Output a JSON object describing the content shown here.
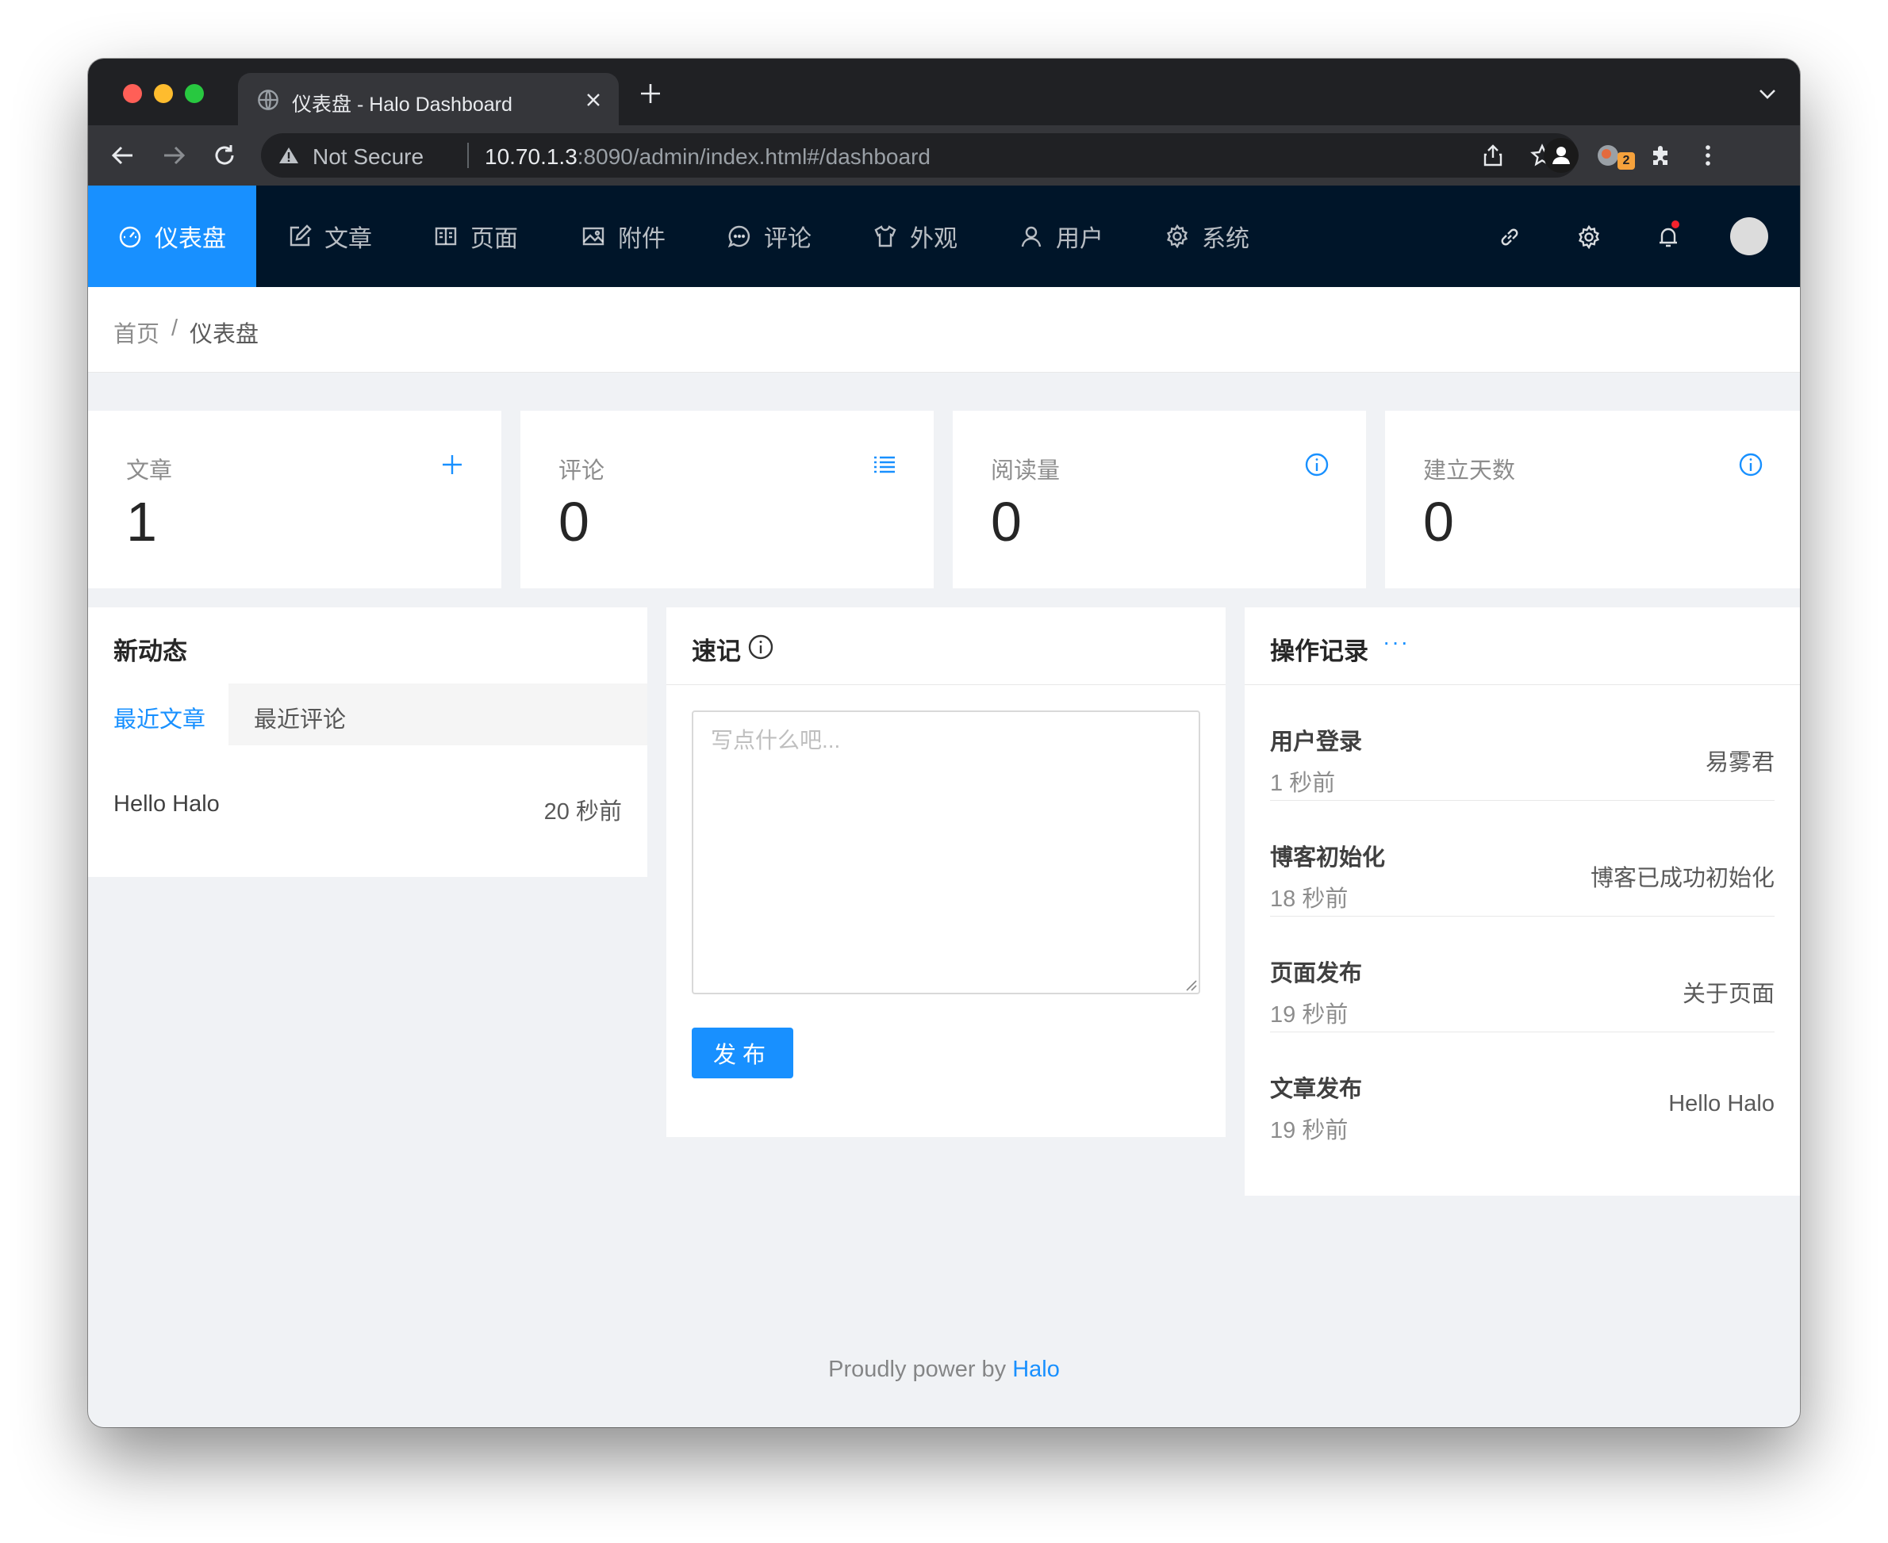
{
  "browser": {
    "tab_title": "仪表盘 - Halo Dashboard",
    "security_label": "Not Secure",
    "url_host": "10.70.1.3",
    "url_path": ":8090/admin/index.html#/dashboard",
    "extension_badge": "2"
  },
  "nav": {
    "items": [
      {
        "label": "仪表盘",
        "icon": "dashboard-icon",
        "active": true
      },
      {
        "label": "文章",
        "icon": "edit-icon"
      },
      {
        "label": "页面",
        "icon": "book-icon"
      },
      {
        "label": "附件",
        "icon": "picture-icon"
      },
      {
        "label": "评论",
        "icon": "message-icon"
      },
      {
        "label": "外观",
        "icon": "skin-icon"
      },
      {
        "label": "用户",
        "icon": "user-icon"
      },
      {
        "label": "系统",
        "icon": "setting-icon"
      }
    ],
    "right_icons": [
      "link-icon",
      "setting-icon",
      "bell-icon",
      "avatar"
    ]
  },
  "breadcrumb": {
    "home": "首页",
    "separator": "/",
    "current": "仪表盘"
  },
  "stats": [
    {
      "label": "文章",
      "value": "1",
      "action_icon": "plus-icon"
    },
    {
      "label": "评论",
      "value": "0",
      "action_icon": "list-icon"
    },
    {
      "label": "阅读量",
      "value": "0",
      "action_icon": "info-circle-icon"
    },
    {
      "label": "建立天数",
      "value": "0",
      "action_icon": "info-circle-icon"
    }
  ],
  "activity": {
    "title": "新动态",
    "tabs": [
      "最近文章",
      "最近评论"
    ],
    "posts": [
      {
        "title": "Hello Halo",
        "time": "20 秒前"
      }
    ]
  },
  "memo": {
    "title": "速记",
    "placeholder": "写点什么吧...",
    "publish_label": "发布"
  },
  "log": {
    "title": "操作记录",
    "more": "···",
    "rows": [
      {
        "type": "用户登录",
        "time": "1 秒前",
        "detail": "易雾君"
      },
      {
        "type": "博客初始化",
        "time": "18 秒前",
        "detail": "博客已成功初始化"
      },
      {
        "type": "页面发布",
        "time": "19 秒前",
        "detail": "关于页面"
      },
      {
        "type": "文章发布",
        "time": "19 秒前",
        "detail": "Hello Halo"
      }
    ]
  },
  "footer": {
    "text": "Proudly power by",
    "link": "Halo"
  },
  "colors": {
    "primary": "#1890ff",
    "header_bg": "#001529",
    "page_bg": "#f0f2f5",
    "notification_dot": "#f5222d"
  }
}
